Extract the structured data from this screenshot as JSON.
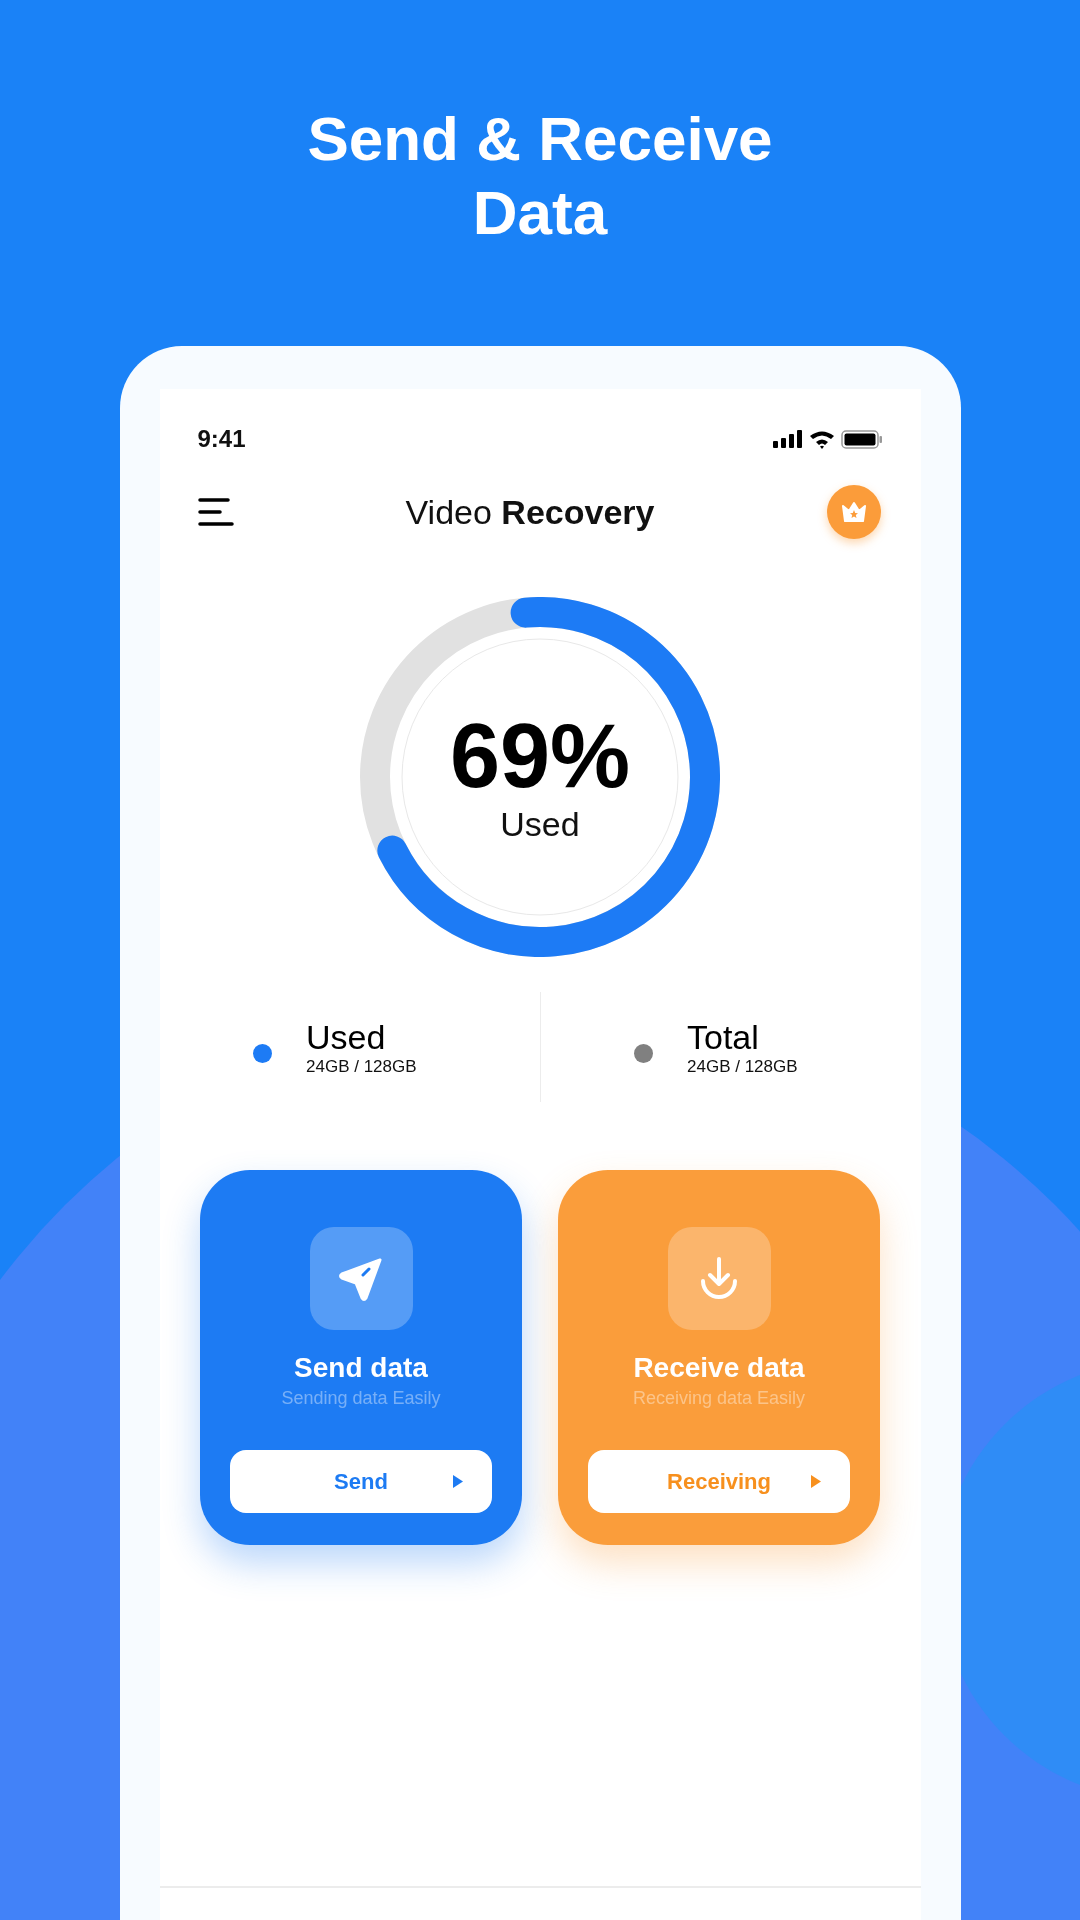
{
  "headline": "Send & Receive Data",
  "status_bar": {
    "time": "9:41"
  },
  "app_bar": {
    "title": "Video **Recovery**"
  },
  "storage": {
    "level": 0.69,
    "percent": "69%",
    "label": "Used"
  },
  "legend": [
    {
      "label": "Used",
      "value": "24GB / 128GB",
      "color": "#1d7bf5"
    },
    {
      "label": "Total",
      "value": "24GB / 128GB",
      "color": "#808080"
    }
  ],
  "actions": [
    {
      "kind": "send",
      "title": "Send data",
      "subtitle": "Sending data Easily",
      "button": "Send"
    },
    {
      "kind": "receive",
      "title": "Receive data",
      "subtitle": "Receiving data Easily",
      "button": "Receiving"
    }
  ]
}
